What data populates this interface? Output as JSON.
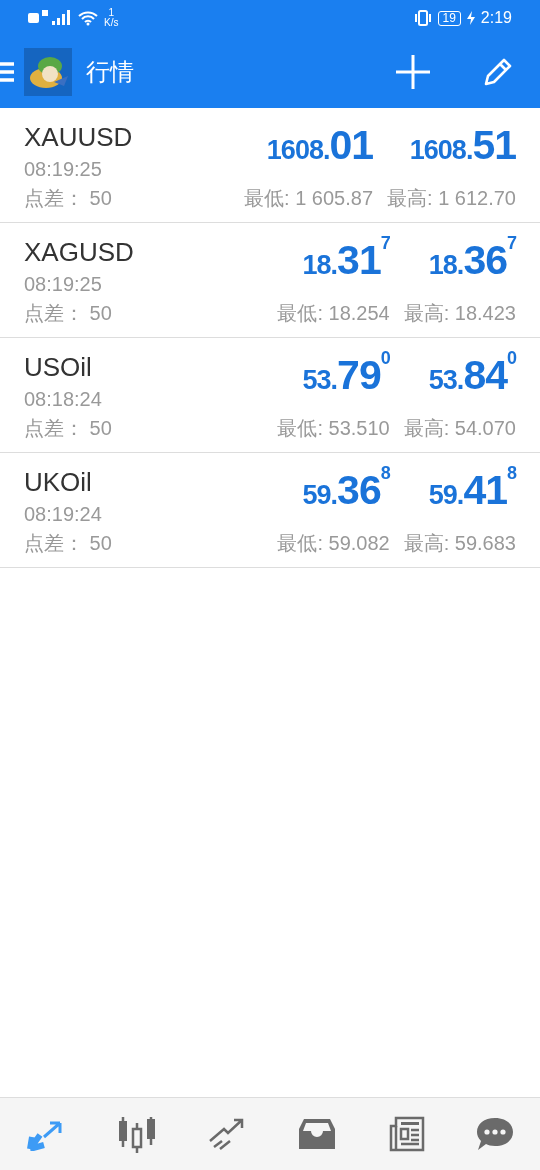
{
  "status_bar": {
    "speed_value": "1",
    "speed_unit": "K/s",
    "battery": "19",
    "time": "2:19"
  },
  "header": {
    "title": "行情"
  },
  "quotes": [
    {
      "symbol": "XAUUSD",
      "time": "08:19:25",
      "spread_label": "点差：",
      "spread": "50",
      "bid": {
        "head": "1608.",
        "big": "01"
      },
      "ask": {
        "head": "1608.",
        "big": "51"
      },
      "low": "最低: 1 605.87",
      "high": "最高: 1 612.70"
    },
    {
      "symbol": "XAGUSD",
      "time": "08:19:25",
      "spread_label": "点差：",
      "spread": "50",
      "bid": {
        "head": "18.",
        "big": "31",
        "sup": "7"
      },
      "ask": {
        "head": "18.",
        "big": "36",
        "sup": "7"
      },
      "low": "最低: 18.254",
      "high": "最高: 18.423"
    },
    {
      "symbol": "USOil",
      "time": "08:18:24",
      "spread_label": "点差：",
      "spread": "50",
      "bid": {
        "head": "53.",
        "big": "79",
        "sup": "0"
      },
      "ask": {
        "head": "53.",
        "big": "84",
        "sup": "0"
      },
      "low": "最低: 53.510",
      "high": "最高: 54.070"
    },
    {
      "symbol": "UKOil",
      "time": "08:19:24",
      "spread_label": "点差：",
      "spread": "50",
      "bid": {
        "head": "59.",
        "big": "36",
        "sup": "8"
      },
      "ask": {
        "head": "59.",
        "big": "41",
        "sup": "8"
      },
      "low": "最低: 59.082",
      "high": "最高: 59.683"
    }
  ],
  "bottom_nav": [
    {
      "kind": "quotes",
      "selected": true
    },
    {
      "kind": "chart",
      "selected": false
    },
    {
      "kind": "trade",
      "selected": false
    },
    {
      "kind": "history",
      "selected": false
    },
    {
      "kind": "news",
      "selected": false
    },
    {
      "kind": "chat",
      "selected": false
    }
  ]
}
